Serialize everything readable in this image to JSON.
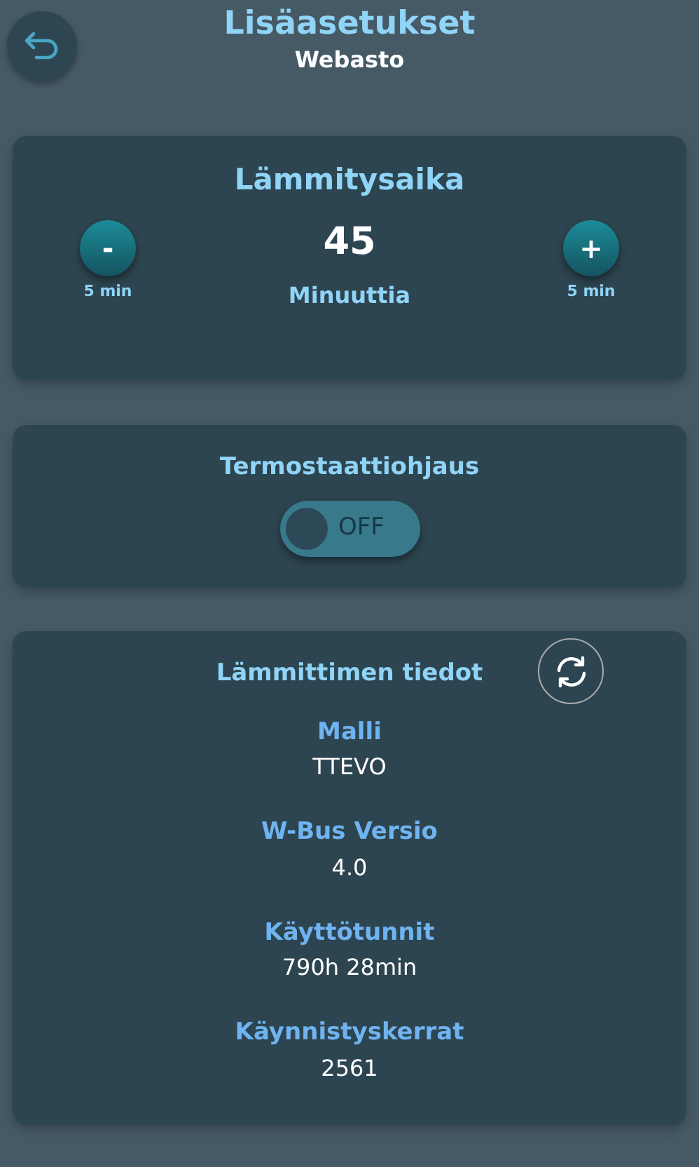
{
  "header": {
    "title": "Lisäasetukset",
    "subtitle": "Webasto"
  },
  "heating_time": {
    "title": "Lämmitysaika",
    "decrease": {
      "symbol": "-",
      "step": "5 min"
    },
    "value": "45",
    "unit": "Minuuttia",
    "increase": {
      "symbol": "+",
      "step": "5 min"
    }
  },
  "thermostat": {
    "title": "Termostaattiohjaus",
    "on": false,
    "label": "OFF"
  },
  "heater_info": {
    "title": "Lämmittimen tiedot",
    "items": [
      {
        "label": "Malli",
        "value": "TTEVO"
      },
      {
        "label": "W-Bus Versio",
        "value": "4.0"
      },
      {
        "label": "Käyttötunnit",
        "value": "790h 28min"
      },
      {
        "label": "Käynnistyskerrat",
        "value": "2561"
      }
    ]
  }
}
